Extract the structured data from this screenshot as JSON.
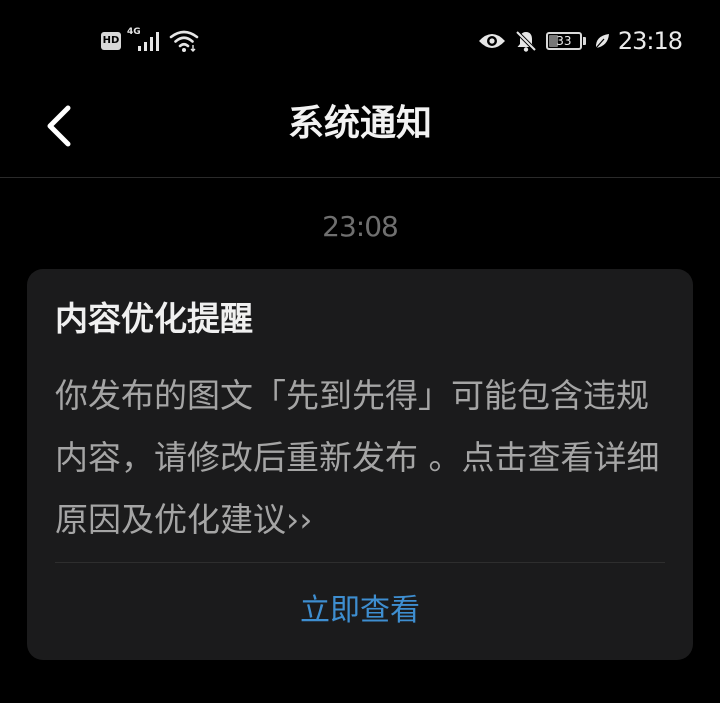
{
  "status_bar": {
    "hd_label": "HD",
    "network_label": "4G",
    "battery_level": "33",
    "time": "23:18",
    "icons": [
      "hd-icon",
      "signal-icon",
      "wifi-icon",
      "eye-icon",
      "bell-off-icon",
      "battery-icon",
      "leaf-icon"
    ]
  },
  "header": {
    "title": "系统通知",
    "back_icon": "chevron-left-icon"
  },
  "message": {
    "time": "23:08",
    "card": {
      "title": "内容优化提醒",
      "body": "你发布的图文「先到先得」可能包含违规内容，请修改后重新发布 。点击查看详细原因及优化建议››",
      "action_label": "立即查看",
      "action_color": "#3e8ed0"
    }
  }
}
